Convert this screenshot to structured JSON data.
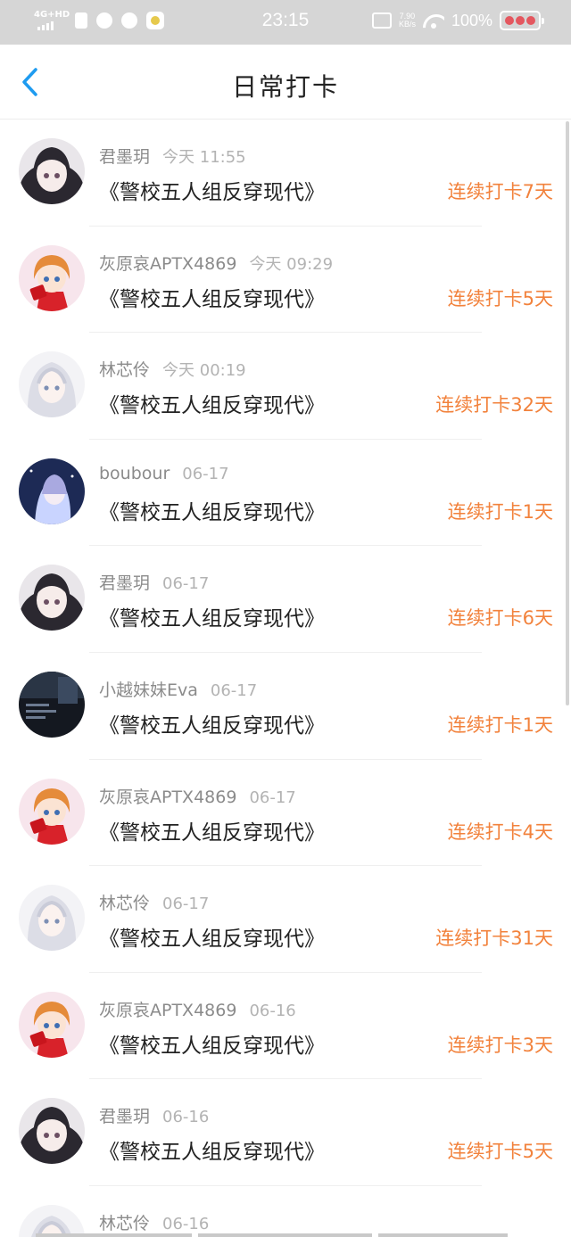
{
  "status": {
    "network": "4G+HD",
    "time": "23:15",
    "speed": "7.90\nKB/s",
    "battery": "100%"
  },
  "nav": {
    "back_icon": "chevron-left-icon",
    "title": "日常打卡",
    "accent": "#1e9bf0"
  },
  "colors": {
    "streak": "#f2823c"
  },
  "entries": [
    {
      "user": "君墨玥",
      "time": "今天 11:55",
      "book": "《警校五人组反穿现代》",
      "streak": "连续打卡7天",
      "avatar": "avatar-girl-dark-hair"
    },
    {
      "user": "灰原哀APTX4869",
      "time": "今天 09:29",
      "book": "《警校五人组反穿现代》",
      "streak": "连续打卡5天",
      "avatar": "avatar-girl-orange-hair"
    },
    {
      "user": "林芯伶",
      "time": "今天 00:19",
      "book": "《警校五人组反穿现代》",
      "streak": "连续打卡32天",
      "avatar": "avatar-girl-white-hair"
    },
    {
      "user": "boubour",
      "time": "06-17",
      "book": "《警校五人组反穿现代》",
      "streak": "连续打卡1天",
      "avatar": "avatar-girl-night-sky"
    },
    {
      "user": "君墨玥",
      "time": "06-17",
      "book": "《警校五人组反穿现代》",
      "streak": "连续打卡6天",
      "avatar": "avatar-girl-dark-hair"
    },
    {
      "user": "小越妹妹Eva",
      "time": "06-17",
      "book": "《警校五人组反穿现代》",
      "streak": "连续打卡1天",
      "avatar": "avatar-dark-scene"
    },
    {
      "user": "灰原哀APTX4869",
      "time": "06-17",
      "book": "《警校五人组反穿现代》",
      "streak": "连续打卡4天",
      "avatar": "avatar-girl-orange-hair"
    },
    {
      "user": "林芯伶",
      "time": "06-17",
      "book": "《警校五人组反穿现代》",
      "streak": "连续打卡31天",
      "avatar": "avatar-girl-white-hair"
    },
    {
      "user": "灰原哀APTX4869",
      "time": "06-16",
      "book": "《警校五人组反穿现代》",
      "streak": "连续打卡3天",
      "avatar": "avatar-girl-orange-hair"
    },
    {
      "user": "君墨玥",
      "time": "06-16",
      "book": "《警校五人组反穿现代》",
      "streak": "连续打卡5天",
      "avatar": "avatar-girl-dark-hair"
    },
    {
      "user": "林芯伶",
      "time": "06-16",
      "book": "",
      "streak": "",
      "avatar": "avatar-girl-white-hair"
    }
  ]
}
